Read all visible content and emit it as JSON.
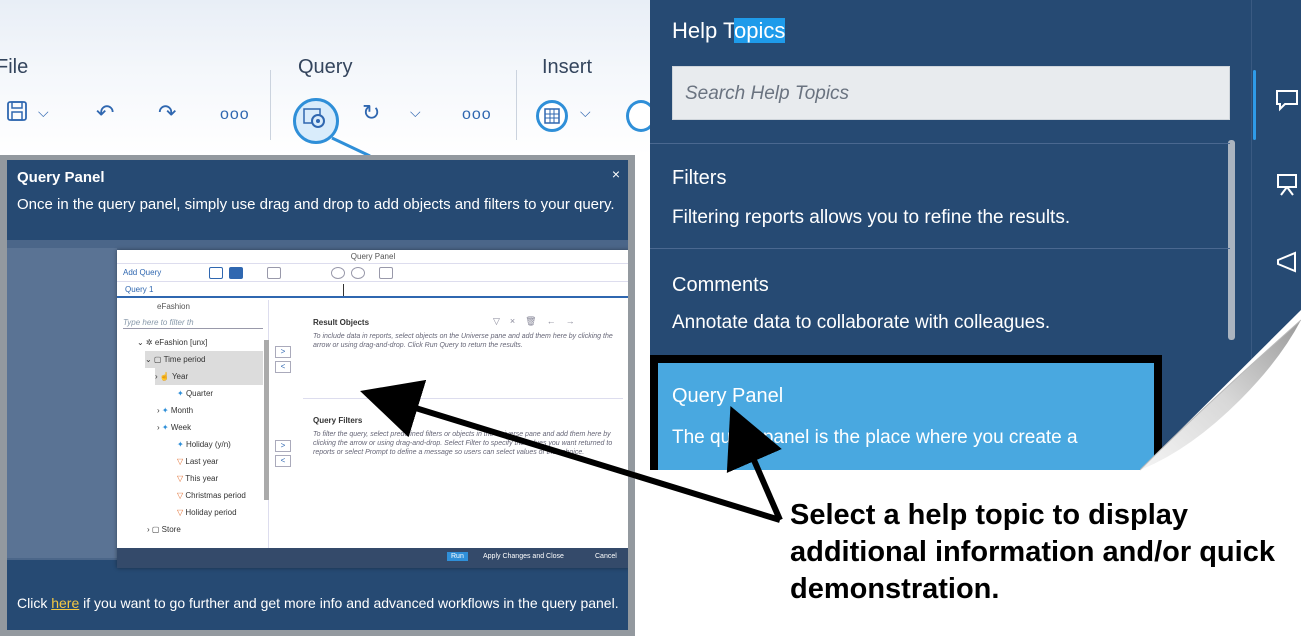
{
  "toolbar": {
    "file_label": "File",
    "query_label": "Query",
    "insert_label": "Insert",
    "more_dots": "ooo"
  },
  "query_panel": {
    "title": "Query Panel",
    "close": "×",
    "description": "Once in the query panel, simply use drag and drop to add objects and filters to your query.",
    "footer_pre": "Click ",
    "footer_link": "here",
    "footer_post": " if you want to go further and get more info and advanced workflows in the query panel.",
    "window": {
      "header": "Query Panel",
      "add_query": "Add Query",
      "query_tab": "Query 1",
      "universe": "eFashion",
      "search_placeholder": "Type here to filter th",
      "tree": [
        "eFashion [unx]",
        "Time period",
        "Year",
        "Quarter",
        "Month",
        "Week",
        "Holiday (y/n)",
        "Last year",
        "This year",
        "Christmas period",
        "Holiday period",
        "Store"
      ],
      "result_objects_title": "Result Objects",
      "result_objects_text": "To include data in reports, select objects on the Universe pane and add them here by clicking the arrow or using drag-and-drop. Click Run Query to return the results.",
      "query_filters_title": "Query Filters",
      "query_filters_text": "To filter the query, select predefined filters or objects in the Universe pane and add them here by clicking the arrow or using drag-and-drop. Select Filter to specify the values you want returned to reports or select Prompt to define a message so users can select values of their choice.",
      "run": "Run",
      "apply": "Apply Changes and Close",
      "cancel": "Cancel"
    }
  },
  "help": {
    "title_plain": "Help T",
    "title_selected": "opics",
    "search_placeholder": "Search Help Topics",
    "topics": [
      {
        "title": "Filters",
        "desc": "Filtering reports allows you to refine the results."
      },
      {
        "title": "Comments",
        "desc": "Annotate data to collaborate with colleagues."
      },
      {
        "title": "Query Panel",
        "desc": "The query panel is the place where you create a"
      }
    ]
  },
  "annotation": {
    "caption": "Select a help topic to display additional information and/or quick demonstration."
  },
  "colors": {
    "panel_navy": "#264a73",
    "highlight_blue": "#49a8e0",
    "accent_blue": "#2f8fd8",
    "link_yellow": "#f5c842"
  }
}
